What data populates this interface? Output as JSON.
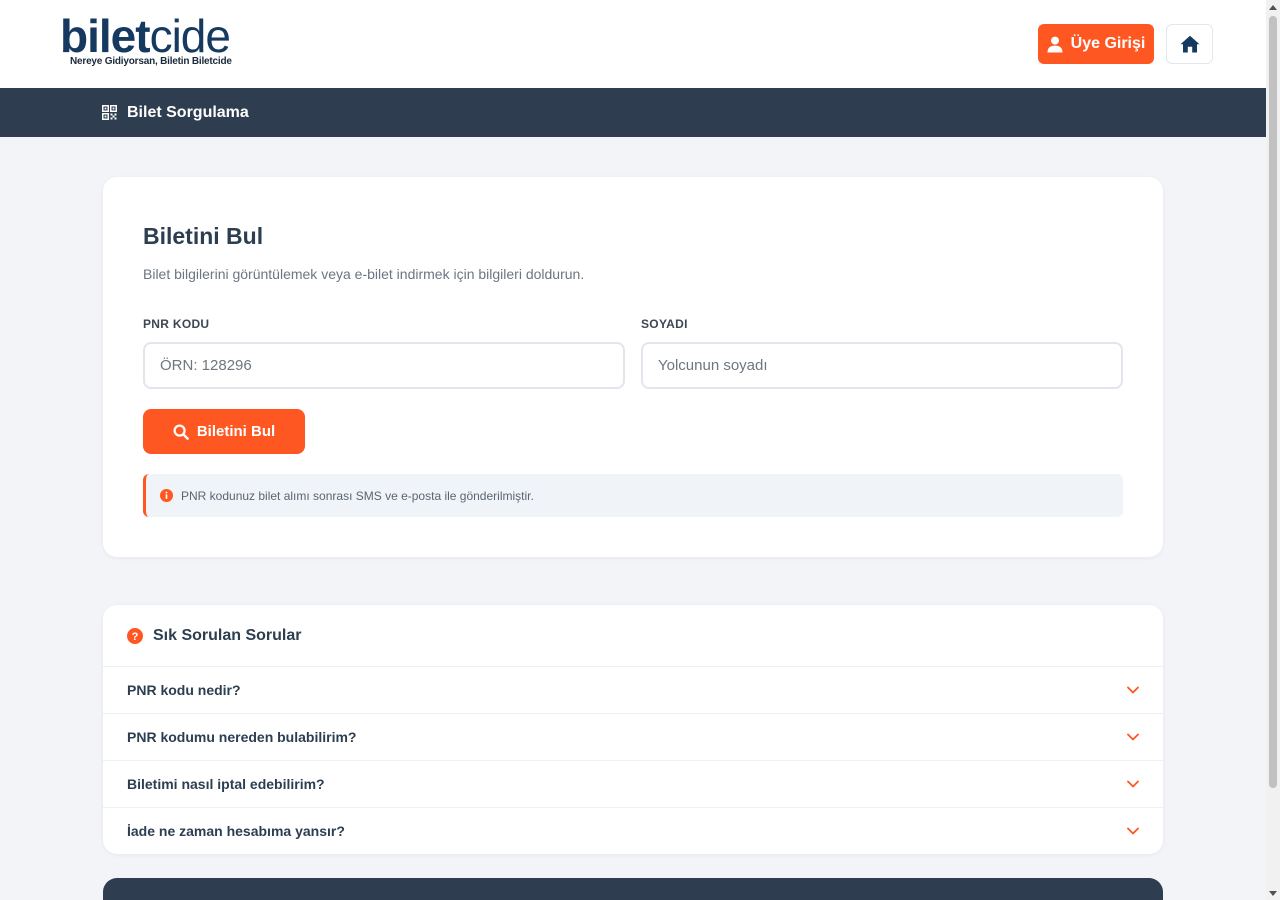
{
  "brand": {
    "logo_bold": "bilet",
    "logo_light": "cide",
    "tagline": "Nereye Gidiyorsan, Biletin Biletcide"
  },
  "header": {
    "login_label": "Üye Girişi"
  },
  "nav": {
    "item_label": "Bilet Sorgulama"
  },
  "search": {
    "title": "Biletini Bul",
    "subtitle": "Bilet bilgilerini görüntülemek veya e-bilet indirmek için bilgileri doldurun.",
    "pnr_label": "PNR KODU",
    "pnr_placeholder": "ÖRN: 128296",
    "pnr_value": "",
    "surname_label": "SOYADI",
    "surname_placeholder": "Yolcunun soyadı",
    "surname_value": "",
    "submit_label": "Biletini Bul",
    "info_text": "PNR kodunuz bilet alımı sonrası SMS ve e-posta ile gönderilmiştir."
  },
  "faq": {
    "title": "Sık Sorulan Sorular",
    "items": [
      {
        "question": "PNR kodu nedir?"
      },
      {
        "question": "PNR kodumu nereden bulabilirim?"
      },
      {
        "question": "Biletimi nasıl iptal edebilirim?"
      },
      {
        "question": "İade ne zaman hesabıma yansır?"
      }
    ]
  },
  "colors": {
    "accent": "#ff5722",
    "navy": "#2e3e50",
    "brand_blue": "#163a5f",
    "page_bg": "#f2f4f8"
  },
  "icons": {
    "login": "user-icon",
    "home": "home-icon",
    "nav": "qr-code-icon",
    "search": "search-icon",
    "info": "info-circle-icon",
    "faq": "question-circle-icon",
    "faq_toggle": "chevron-down-icon"
  }
}
